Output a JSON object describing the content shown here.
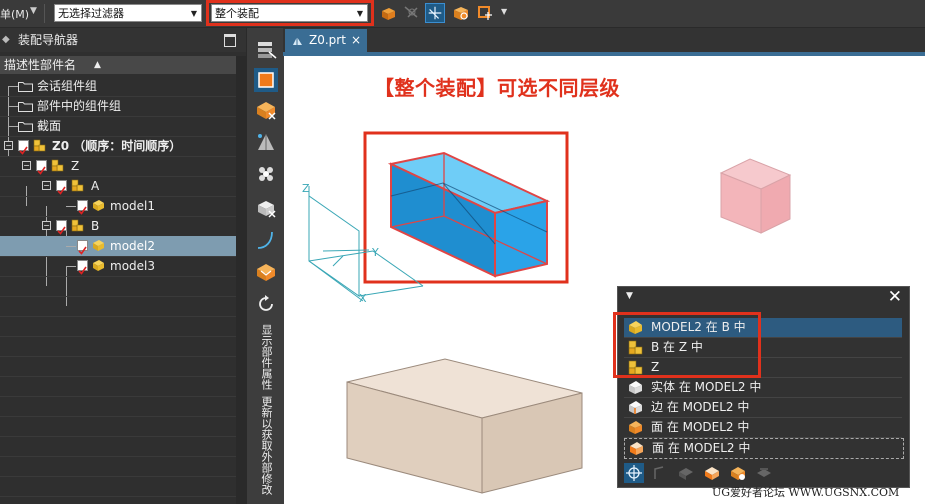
{
  "toolbar": {
    "menu_label": "单(M)",
    "filter_combo": "无选择过滤器",
    "scope_combo": "整个装配"
  },
  "navigator": {
    "title": "装配导航器",
    "column_header": "描述性部件名",
    "rows": [
      {
        "label": "会话组件组"
      },
      {
        "label": "部件中的组件组"
      },
      {
        "label": "截面"
      },
      {
        "label": "Z0 （顺序：时间顺序）"
      },
      {
        "label": "Z"
      },
      {
        "label": "A"
      },
      {
        "label": "model1"
      },
      {
        "label": "B"
      },
      {
        "label": "model2"
      },
      {
        "label": "model3"
      }
    ]
  },
  "side_strip": {
    "text_properties": "显示部件属性",
    "text_update": "更新以获取外部修改"
  },
  "tab": {
    "label": "Z0.prt",
    "close": "×"
  },
  "canvas": {
    "heading": "【整个装配】可选不同层级",
    "axes": {
      "x": "X",
      "y": "Y",
      "z": "Z"
    }
  },
  "quick_pick": {
    "items": [
      {
        "label": "MODEL2 在 B 中",
        "icon": "component-icon"
      },
      {
        "label": "B 在 Z 中",
        "icon": "subassembly-icon"
      },
      {
        "label": "Z",
        "icon": "subassembly-icon"
      },
      {
        "label": "实体 在 MODEL2 中",
        "icon": "solid-body-icon"
      },
      {
        "label": "边 在 MODEL2 中",
        "icon": "edge-icon"
      },
      {
        "label": "面 在 MODEL2 中",
        "icon": "face-icon"
      },
      {
        "label": "面 在 MODEL2 中",
        "icon": "face-icon"
      }
    ]
  },
  "watermark": "UG爱好者论坛 WWW.UGSNX.COM",
  "colors": {
    "accent_red": "#e0311c",
    "selection_blue": "#2d5b80",
    "tab_blue": "#3a6d94"
  }
}
